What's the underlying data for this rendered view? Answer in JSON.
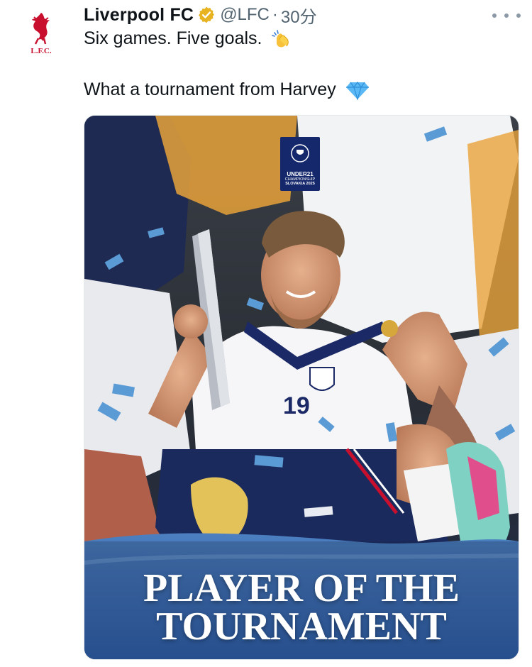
{
  "tweet": {
    "author_name": "Liverpool FC",
    "handle": "@LFC",
    "separator": "·",
    "time": "30分",
    "line1": "Six games. Five goals.",
    "line1_emoji": "clapping-hands",
    "line2": "What a tournament from Harvey",
    "line2_emoji": "gem"
  },
  "avatar": {
    "label": "L.F.C.",
    "color": "#c8102e"
  },
  "media": {
    "badge_title": "UNDER21",
    "badge_subtitle": "CHAMPIONSHIP",
    "badge_location": "SLOVAKIA 2025",
    "caption_line1": "PLAYER OF THE",
    "caption_line2": "TOURNAMENT",
    "shirt_number": "19"
  },
  "colors": {
    "verified": "#e8b321",
    "confetti": "#5b9bd5",
    "shorts": "#1b2a5c"
  }
}
